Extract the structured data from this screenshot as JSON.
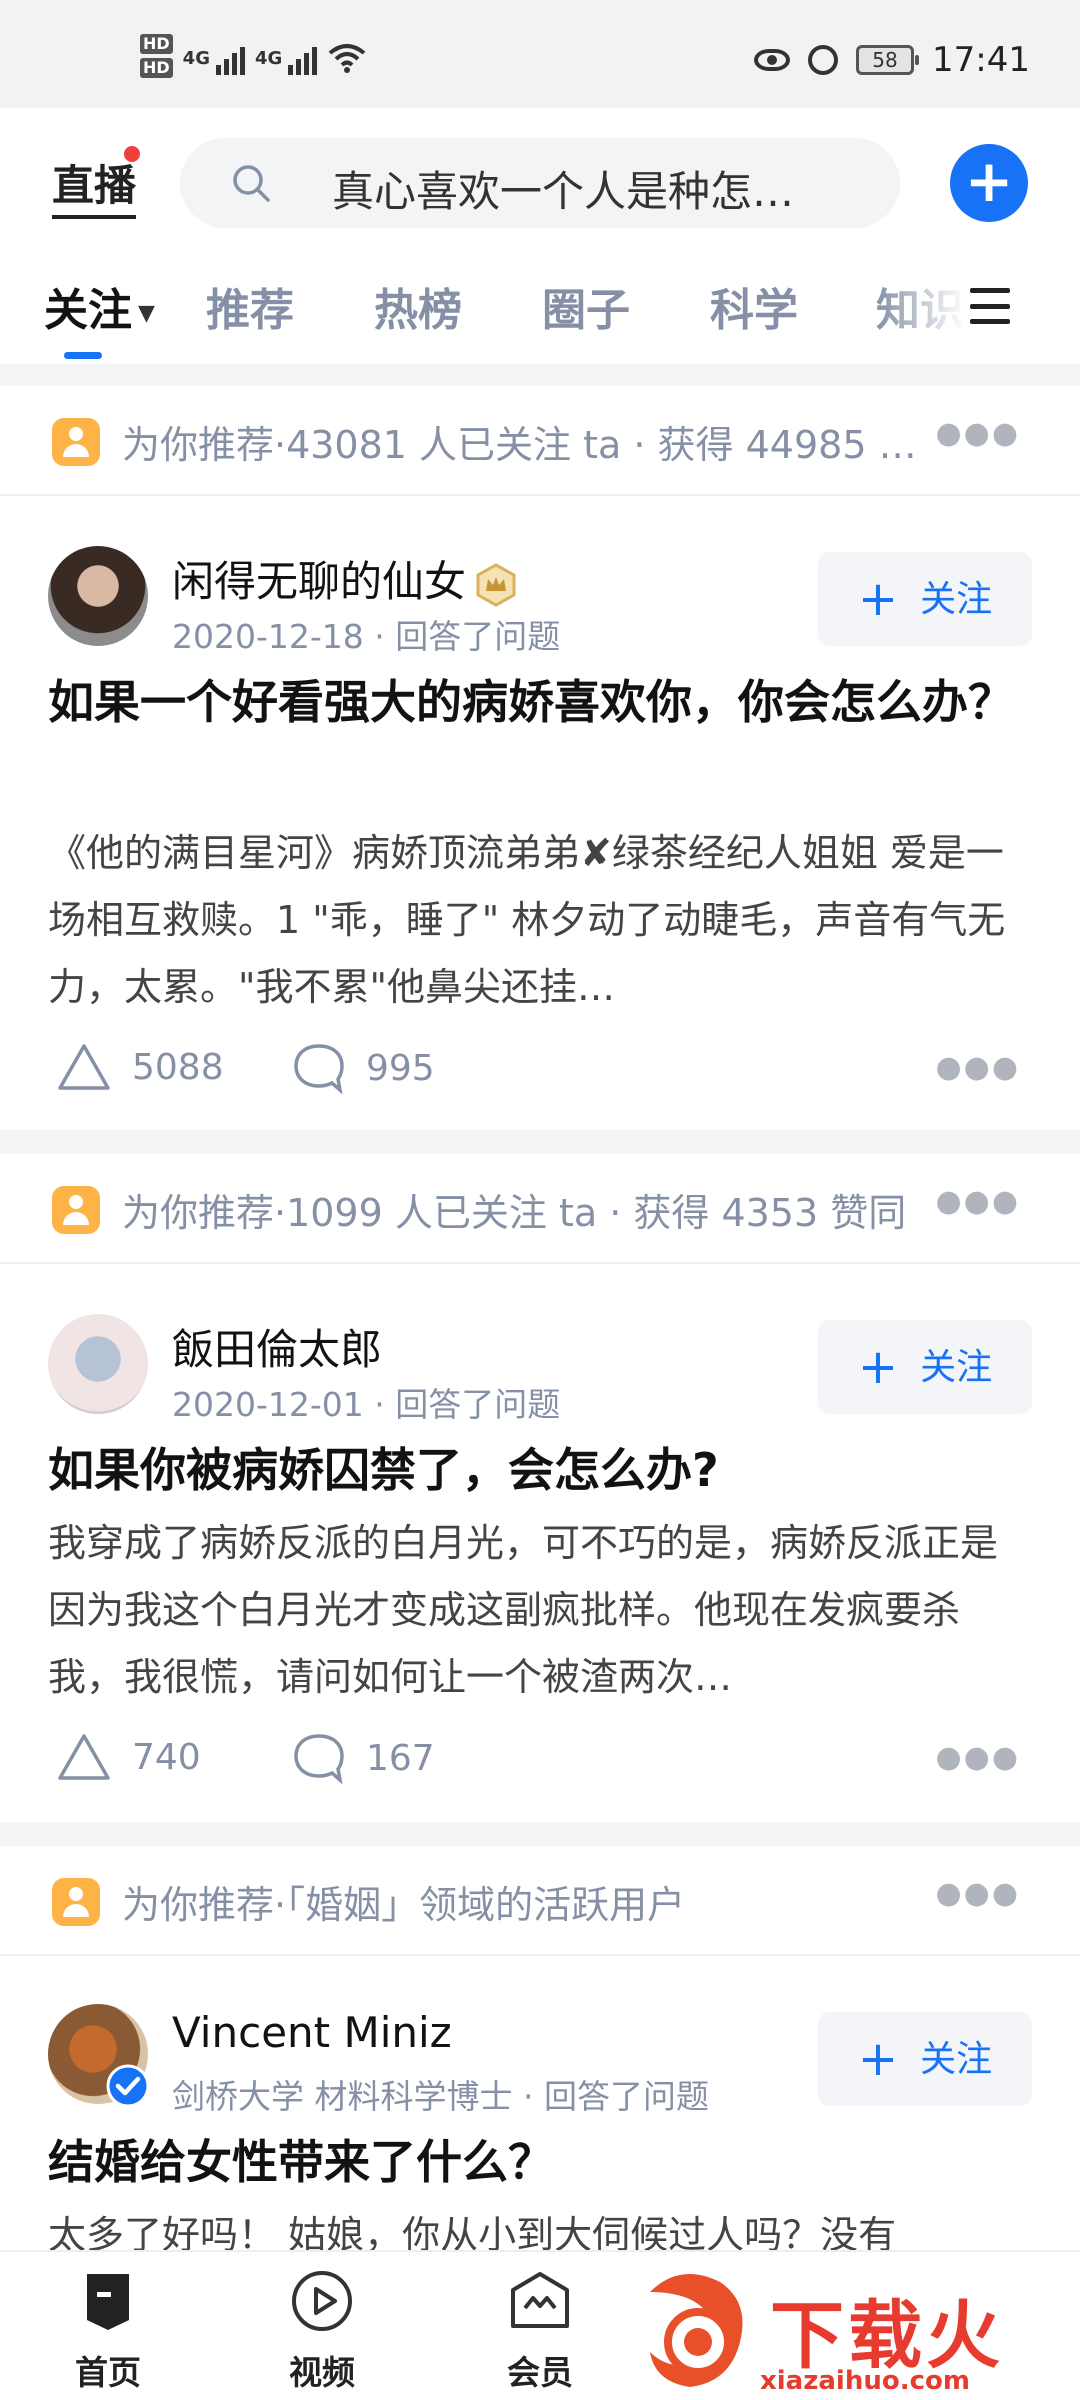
{
  "status_bar": {
    "sim1": "HD",
    "sim2": "HD",
    "network1": "4G",
    "network2": "4G",
    "battery": "58",
    "time": "17:41"
  },
  "header": {
    "live_label": "直播",
    "search_placeholder": "真心喜欢一个人是种怎…",
    "add_button": "+"
  },
  "tabs": [
    {
      "label": "关注"
    },
    {
      "label": "推荐"
    },
    {
      "label": "热榜"
    },
    {
      "label": "圈子"
    },
    {
      "label": "科学"
    },
    {
      "label": "知识"
    }
  ],
  "feed": [
    {
      "recommend": "为你推荐·43081 人已关注 ta · 获得 44985 …",
      "author": "闲得无聊的仙女",
      "meta": "2020-12-18 · 回答了问题",
      "follow": "关注",
      "title": "如果一个好看强大的病娇喜欢你，你会怎么办？",
      "excerpt": "《他的满目星河》病娇顶流弟弟✘绿茶经纪人姐姐 爱是一场相互救赎。1 \"乖，睡了\" 林夕动了动睫毛，声音有气无力，太累。\"我不累\"他鼻尖还挂…",
      "likes": "5088",
      "comments": "995"
    },
    {
      "recommend": "为你推荐·1099 人已关注 ta · 获得 4353 赞同",
      "author": "飯田倫太郎",
      "meta": "2020-12-01 · 回答了问题",
      "follow": "关注",
      "title": "如果你被病娇囚禁了，会怎么办?",
      "excerpt": "我穿成了病娇反派的白月光，可不巧的是，病娇反派正是因为我这个白月光才变成这副疯批样。他现在发疯要杀我，我很慌，请问如何让一个被渣两次…",
      "likes": "740",
      "comments": "167"
    },
    {
      "recommend": "为你推荐·「婚姻」领域的活跃用户",
      "author": "Vincent Miniz",
      "meta": "剑桥大学 材料科学博士 · 回答了问题",
      "follow": "关注",
      "title": "结婚给女性带来了什么？",
      "excerpt": "太多了好吗！ 姑娘，你从小到大伺候过人吗？没有"
    }
  ],
  "bottom_nav": [
    {
      "label": "首页"
    },
    {
      "label": "视频"
    },
    {
      "label": "会员"
    }
  ],
  "watermark": {
    "text": "下载火",
    "url": "xiazaihuo.com"
  }
}
